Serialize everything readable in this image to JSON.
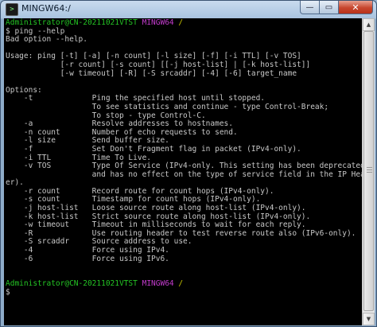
{
  "window": {
    "title": "MINGW64:/",
    "icon_name": "terminal-icon",
    "caption": {
      "minimize": "—",
      "maximize": "▭",
      "close": "✕"
    }
  },
  "colors": {
    "prompt_user": "#24c624",
    "prompt_mingw": "#c33ccd",
    "prompt_path": "#c8c400",
    "text": "#c8c8c8"
  },
  "prompt": {
    "user_host": "Administrator@CN-20211021VTST",
    "env": "MINGW64",
    "path": "/"
  },
  "session": {
    "command": "$ ping --help",
    "output": [
      "Bad option --help.",
      "",
      "Usage: ping [-t] [-a] [-n count] [-l size] [-f] [-i TTL] [-v TOS]",
      "            [-r count] [-s count] [[-j host-list] | [-k host-list]]",
      "            [-w timeout] [-R] [-S srcaddr] [-4] [-6] target_name",
      "",
      "Options:",
      "    -t             Ping the specified host until stopped.",
      "                   To see statistics and continue - type Control-Break;",
      "                   To stop - type Control-C.",
      "    -a             Resolve addresses to hostnames.",
      "    -n count       Number of echo requests to send.",
      "    -l size        Send buffer size.",
      "    -f             Set Don't Fragment flag in packet (IPv4-only).",
      "    -i TTL         Time To Live.",
      "    -v TOS         Type Of Service (IPv4-only. This setting has been deprecated",
      "                   and has no effect on the type of service field in the IP Head",
      "er).",
      "    -r count       Record route for count hops (IPv4-only).",
      "    -s count       Timestamp for count hops (IPv4-only).",
      "    -j host-list   Loose source route along host-list (IPv4-only).",
      "    -k host-list   Strict source route along host-list (IPv4-only).",
      "    -w timeout     Timeout in milliseconds to wait for each reply.",
      "    -R             Use routing header to test reverse route also (IPv6-only).",
      "    -S srcaddr     Source address to use.",
      "    -4             Force using IPv4.",
      "    -6             Force using IPv6.",
      "",
      ""
    ],
    "cursor_line": "$ "
  },
  "scrollbar": {
    "up_arrow": "▲",
    "down_arrow": "▼"
  }
}
